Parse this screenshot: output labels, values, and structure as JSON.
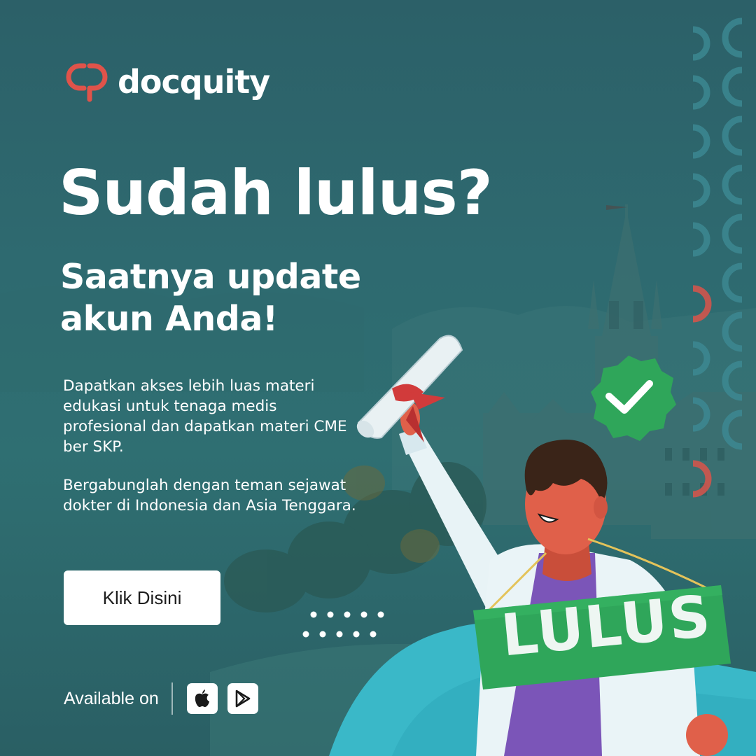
{
  "brand": {
    "name": "docquity"
  },
  "headline": "Sudah lulus?",
  "subheadline": [
    "Saatnya update",
    "akun Anda!"
  ],
  "body": [
    "Dapatkan akses lebih luas materi edukasi untuk tenaga medis profesional dan dapatkan materi CME ber SKP.",
    "Bergabunglah dengan teman sejawat dokter di Indonesia dan Asia Tenggara."
  ],
  "cta": {
    "label": "Klik Disini"
  },
  "availability": {
    "label": "Available on",
    "stores": [
      "apple-icon",
      "google-play-icon"
    ]
  },
  "illustration": {
    "sign_text": "LULUS",
    "check_badge_icon": "check-badge-icon",
    "diploma_icon": "diploma-icon"
  },
  "colors": {
    "background": "#2e6a70",
    "brand_red": "#e0534a",
    "sign_green": "#2fa65a",
    "accent_teal": "#3ab8c8",
    "skin": "#e0604a",
    "shirt": "#7b55b8"
  }
}
